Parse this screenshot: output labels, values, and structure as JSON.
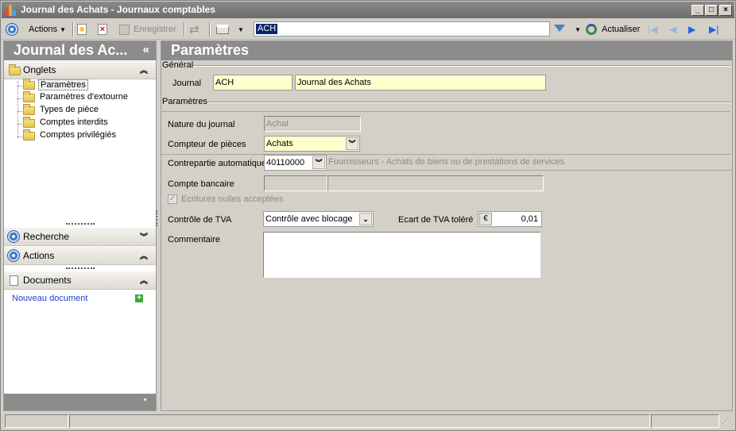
{
  "window": {
    "title": "Journal des Achats  -  Journaux comptables"
  },
  "toolbar": {
    "actions_label": "Actions",
    "save_label": "Enregistrer",
    "search_value": "ACH",
    "refresh_label": "Actualiser"
  },
  "left": {
    "header": "Journal des Ac...",
    "collapse_glyph": "«",
    "onglets_label": "Onglets",
    "tabs": [
      {
        "label": "Paramètres"
      },
      {
        "label": "Paramètres d'extourne"
      },
      {
        "label": "Types de pièce"
      },
      {
        "label": "Comptes interdits"
      },
      {
        "label": "Comptes privilégiés"
      }
    ],
    "recherche_label": "Recherche",
    "actions_label": "Actions",
    "documents_label": "Documents",
    "new_document_label": "Nouveau document"
  },
  "right": {
    "header": "Paramètres",
    "general_group": "Général",
    "journal_label": "Journal",
    "journal_code": "ACH",
    "journal_name": "Journal des Achats",
    "params_group": "Paramètres",
    "nature_label": "Nature du journal",
    "nature_value": "Achat",
    "counter_label": "Compteur de pièces",
    "counter_value": "Achats",
    "contrepartie_label": "Contrepartie automatique",
    "contrepartie_value": "40110000",
    "contrepartie_desc": "Fournisseurs - Achats de biens ou de prestations de services",
    "compte_bancaire_label": "Compte bancaire",
    "ecritures_label": "Ecritures nulles acceptées",
    "tva_control_label": "Contrôle de TVA",
    "tva_control_value": "Contrôle avec blocage",
    "ecart_label": "Ecart de TVA toléré",
    "ecart_currency": "€",
    "ecart_value": "0,01",
    "comment_label": "Commentaire",
    "comment_value": ""
  }
}
